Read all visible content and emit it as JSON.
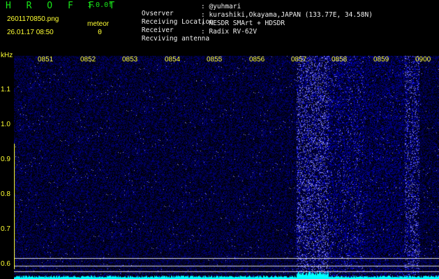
{
  "app": {
    "name": "H R O F F T",
    "version": "1.0.0f"
  },
  "file": {
    "name": "2601170850.png",
    "datetime": "26.01.17 08:50"
  },
  "meteor": {
    "label": "meteor",
    "count": "0"
  },
  "info": [
    {
      "label": "Ovserver",
      "value": ": @yuhmari"
    },
    {
      "label": "Receiving Location",
      "value": ": kurashiki,Okayama,JAPAN (133.77E, 34.58N)"
    },
    {
      "label": "Receiver",
      "value": ": NESDR SMArt + HDSDR"
    },
    {
      "label": "Recviving antenna",
      "value": ": Radix RV-62V"
    }
  ],
  "axes": {
    "y_unit": "kHz",
    "y_ticks": [
      "1.1",
      "1.0",
      "0.9",
      "0.8",
      "0.7",
      "0.6"
    ],
    "time_ticks": [
      "0851",
      "0852",
      "0853",
      "0854",
      "0855",
      "0856",
      "0857",
      "0858",
      "0859",
      "0900"
    ]
  },
  "colors": {
    "label": "#ffff33",
    "brand": "#19e619",
    "signal": "#0a1cff",
    "trace": "#00ffff"
  }
}
